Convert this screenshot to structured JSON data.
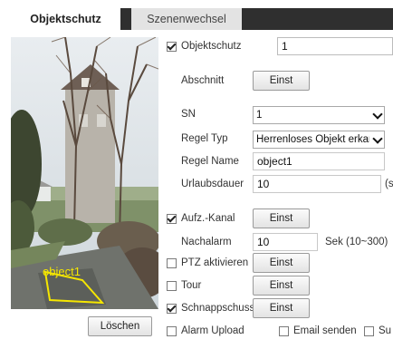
{
  "tabs": [
    {
      "label": "Objektschutz",
      "active": true
    },
    {
      "label": "Szenenwechsel",
      "active": false
    }
  ],
  "preview": {
    "region_label": "object1",
    "region_color": "#f5e600"
  },
  "buttons": {
    "delete": "Löschen",
    "abschnitt_einst": "Einst",
    "aufz_einst": "Einst",
    "ptz_einst": "Einst",
    "tour_einst": "Einst",
    "schnapp_einst": "Einst"
  },
  "settings": {
    "objektschutz": {
      "label": "Objektschutz",
      "checked": true,
      "value": "1"
    },
    "abschnitt": {
      "label": "Abschnitt"
    },
    "sn": {
      "label": "SN",
      "value": "1"
    },
    "regel_typ": {
      "label": "Regel Typ",
      "value": "Herrenloses Objekt erkan"
    },
    "regel_name": {
      "label": "Regel Name",
      "value": "object1"
    },
    "urlaubsdauer": {
      "label": "Urlaubsdauer",
      "value": "10",
      "unit": "(s"
    },
    "aufz_kanal": {
      "label": "Aufz.-Kanal",
      "checked": true
    },
    "nachalarm": {
      "label": "Nachalarm",
      "value": "10",
      "unit": "Sek (10~300)"
    },
    "ptz": {
      "label": "PTZ aktivieren",
      "checked": false
    },
    "tour": {
      "label": "Tour",
      "checked": false
    },
    "schnappschuss": {
      "label": "Schnappschuss",
      "checked": true
    },
    "alarm_upload": {
      "label": "Alarm Upload",
      "checked": false
    },
    "email": {
      "label": "Email senden",
      "checked": false
    },
    "su": {
      "label": "Su",
      "checked": false
    }
  }
}
